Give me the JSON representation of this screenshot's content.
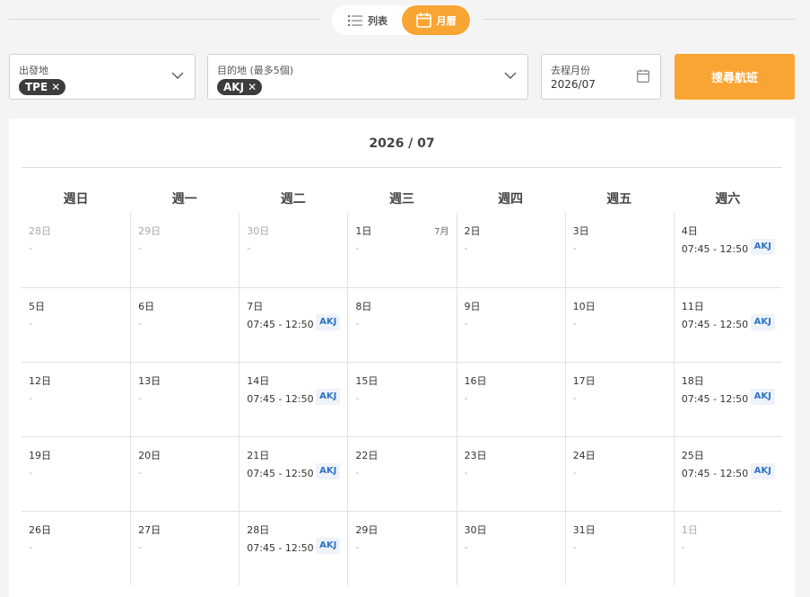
{
  "view_toggle": {
    "list_label": "列表",
    "month_label": "月曆"
  },
  "search": {
    "origin_label": "出發地",
    "origin_chip": "TPE",
    "chip_remove": "✕",
    "dest_label": "目的地 (最多5個)",
    "dest_chip": "AKJ",
    "date_label": "去程月份",
    "date_value": "2026/07",
    "submit_label": "搜尋航班"
  },
  "calendar": {
    "title": "2026 / 07",
    "weekdays": [
      "週日",
      "週一",
      "週二",
      "週三",
      "週四",
      "週五",
      "週六"
    ],
    "weeks": [
      [
        {
          "day": "28日",
          "other": true,
          "empty": "-"
        },
        {
          "day": "29日",
          "other": true,
          "empty": "-"
        },
        {
          "day": "30日",
          "other": true,
          "empty": "-"
        },
        {
          "day": "1日",
          "month_tag": "7月",
          "empty": "-"
        },
        {
          "day": "2日",
          "empty": "-"
        },
        {
          "day": "3日",
          "empty": "-"
        },
        {
          "day": "4日",
          "time": "07:45 - 12:50",
          "airport": "AKJ"
        }
      ],
      [
        {
          "day": "5日",
          "empty": "-"
        },
        {
          "day": "6日",
          "empty": "-"
        },
        {
          "day": "7日",
          "time": "07:45 - 12:50",
          "airport": "AKJ"
        },
        {
          "day": "8日",
          "empty": "-"
        },
        {
          "day": "9日",
          "empty": "-"
        },
        {
          "day": "10日",
          "empty": "-"
        },
        {
          "day": "11日",
          "time": "07:45 - 12:50",
          "airport": "AKJ"
        }
      ],
      [
        {
          "day": "12日",
          "empty": "-"
        },
        {
          "day": "13日",
          "empty": "-"
        },
        {
          "day": "14日",
          "time": "07:45 - 12:50",
          "airport": "AKJ"
        },
        {
          "day": "15日",
          "empty": "-"
        },
        {
          "day": "16日",
          "empty": "-"
        },
        {
          "day": "17日",
          "empty": "-"
        },
        {
          "day": "18日",
          "time": "07:45 - 12:50",
          "airport": "AKJ"
        }
      ],
      [
        {
          "day": "19日",
          "empty": "-"
        },
        {
          "day": "20日",
          "empty": "-"
        },
        {
          "day": "21日",
          "time": "07:45 - 12:50",
          "airport": "AKJ"
        },
        {
          "day": "22日",
          "empty": "-"
        },
        {
          "day": "23日",
          "empty": "-"
        },
        {
          "day": "24日",
          "empty": "-"
        },
        {
          "day": "25日",
          "time": "07:45 - 12:50",
          "airport": "AKJ"
        }
      ],
      [
        {
          "day": "26日",
          "empty": "-"
        },
        {
          "day": "27日",
          "empty": "-"
        },
        {
          "day": "28日",
          "time": "07:45 - 12:50",
          "airport": "AKJ"
        },
        {
          "day": "29日",
          "empty": "-"
        },
        {
          "day": "30日",
          "empty": "-"
        },
        {
          "day": "31日",
          "empty": "-"
        },
        {
          "day": "1日",
          "other": true,
          "empty": "-"
        }
      ]
    ]
  },
  "colors": {
    "accent": "#f9a534",
    "airport_text": "#2f73c4",
    "airport_bg": "#eef3fa",
    "chip_bg": "#3c3c3c"
  }
}
